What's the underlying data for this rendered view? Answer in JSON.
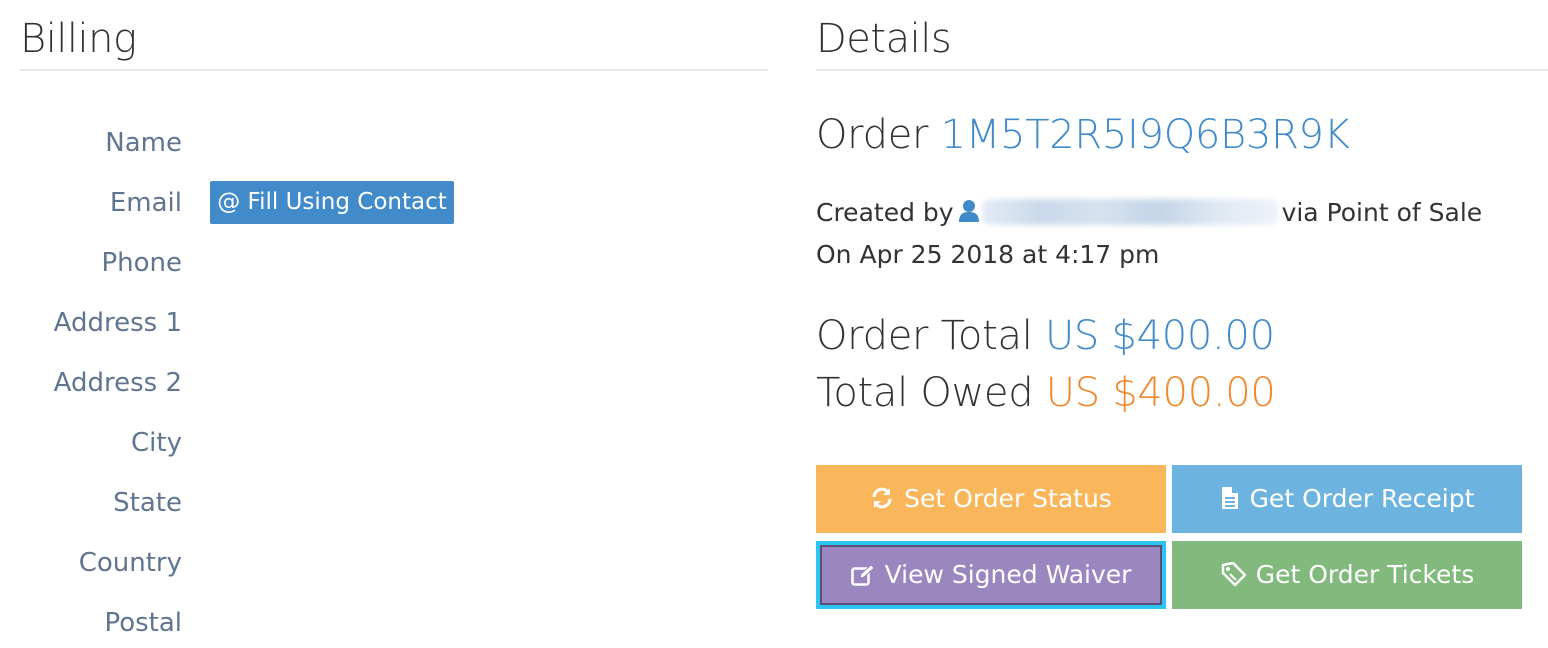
{
  "billing": {
    "title": "Billing",
    "fields": [
      {
        "label": "Name"
      },
      {
        "label": "Email"
      },
      {
        "label": "Phone"
      },
      {
        "label": "Address 1"
      },
      {
        "label": "Address 2"
      },
      {
        "label": "City"
      },
      {
        "label": "State"
      },
      {
        "label": "Country"
      },
      {
        "label": "Postal"
      }
    ],
    "fill_contact_label": "@ Fill Using Contact"
  },
  "details": {
    "title": "Details",
    "order_prefix": "Order",
    "order_id": "1M5T2R5I9Q6B3R9K",
    "created_by_prefix": "Created by",
    "created_via": "via Point of Sale",
    "created_on": "On Apr 25 2018 at 4:17 pm",
    "order_total_label": "Order Total",
    "order_total_value": "US $400.00",
    "total_owed_label": "Total Owed",
    "total_owed_value": "US $400.00",
    "buttons": {
      "set_status": "Set Order Status",
      "get_receipt": "Get Order Receipt",
      "view_waiver": "View Signed Waiver",
      "get_tickets": "Get Order Tickets"
    }
  },
  "colors": {
    "accent_blue": "#428bca",
    "owed_orange": "#f0882e",
    "status_button": "#fab65a",
    "receipt_button": "#6db3e0",
    "waiver_button": "#9b87c0",
    "tickets_button": "#82b97c",
    "label_color": "#5f7590"
  },
  "icons": {
    "user": "user-icon",
    "refresh": "refresh-icon",
    "document": "document-icon",
    "edit": "edit-icon",
    "ticket": "ticket-icon"
  }
}
